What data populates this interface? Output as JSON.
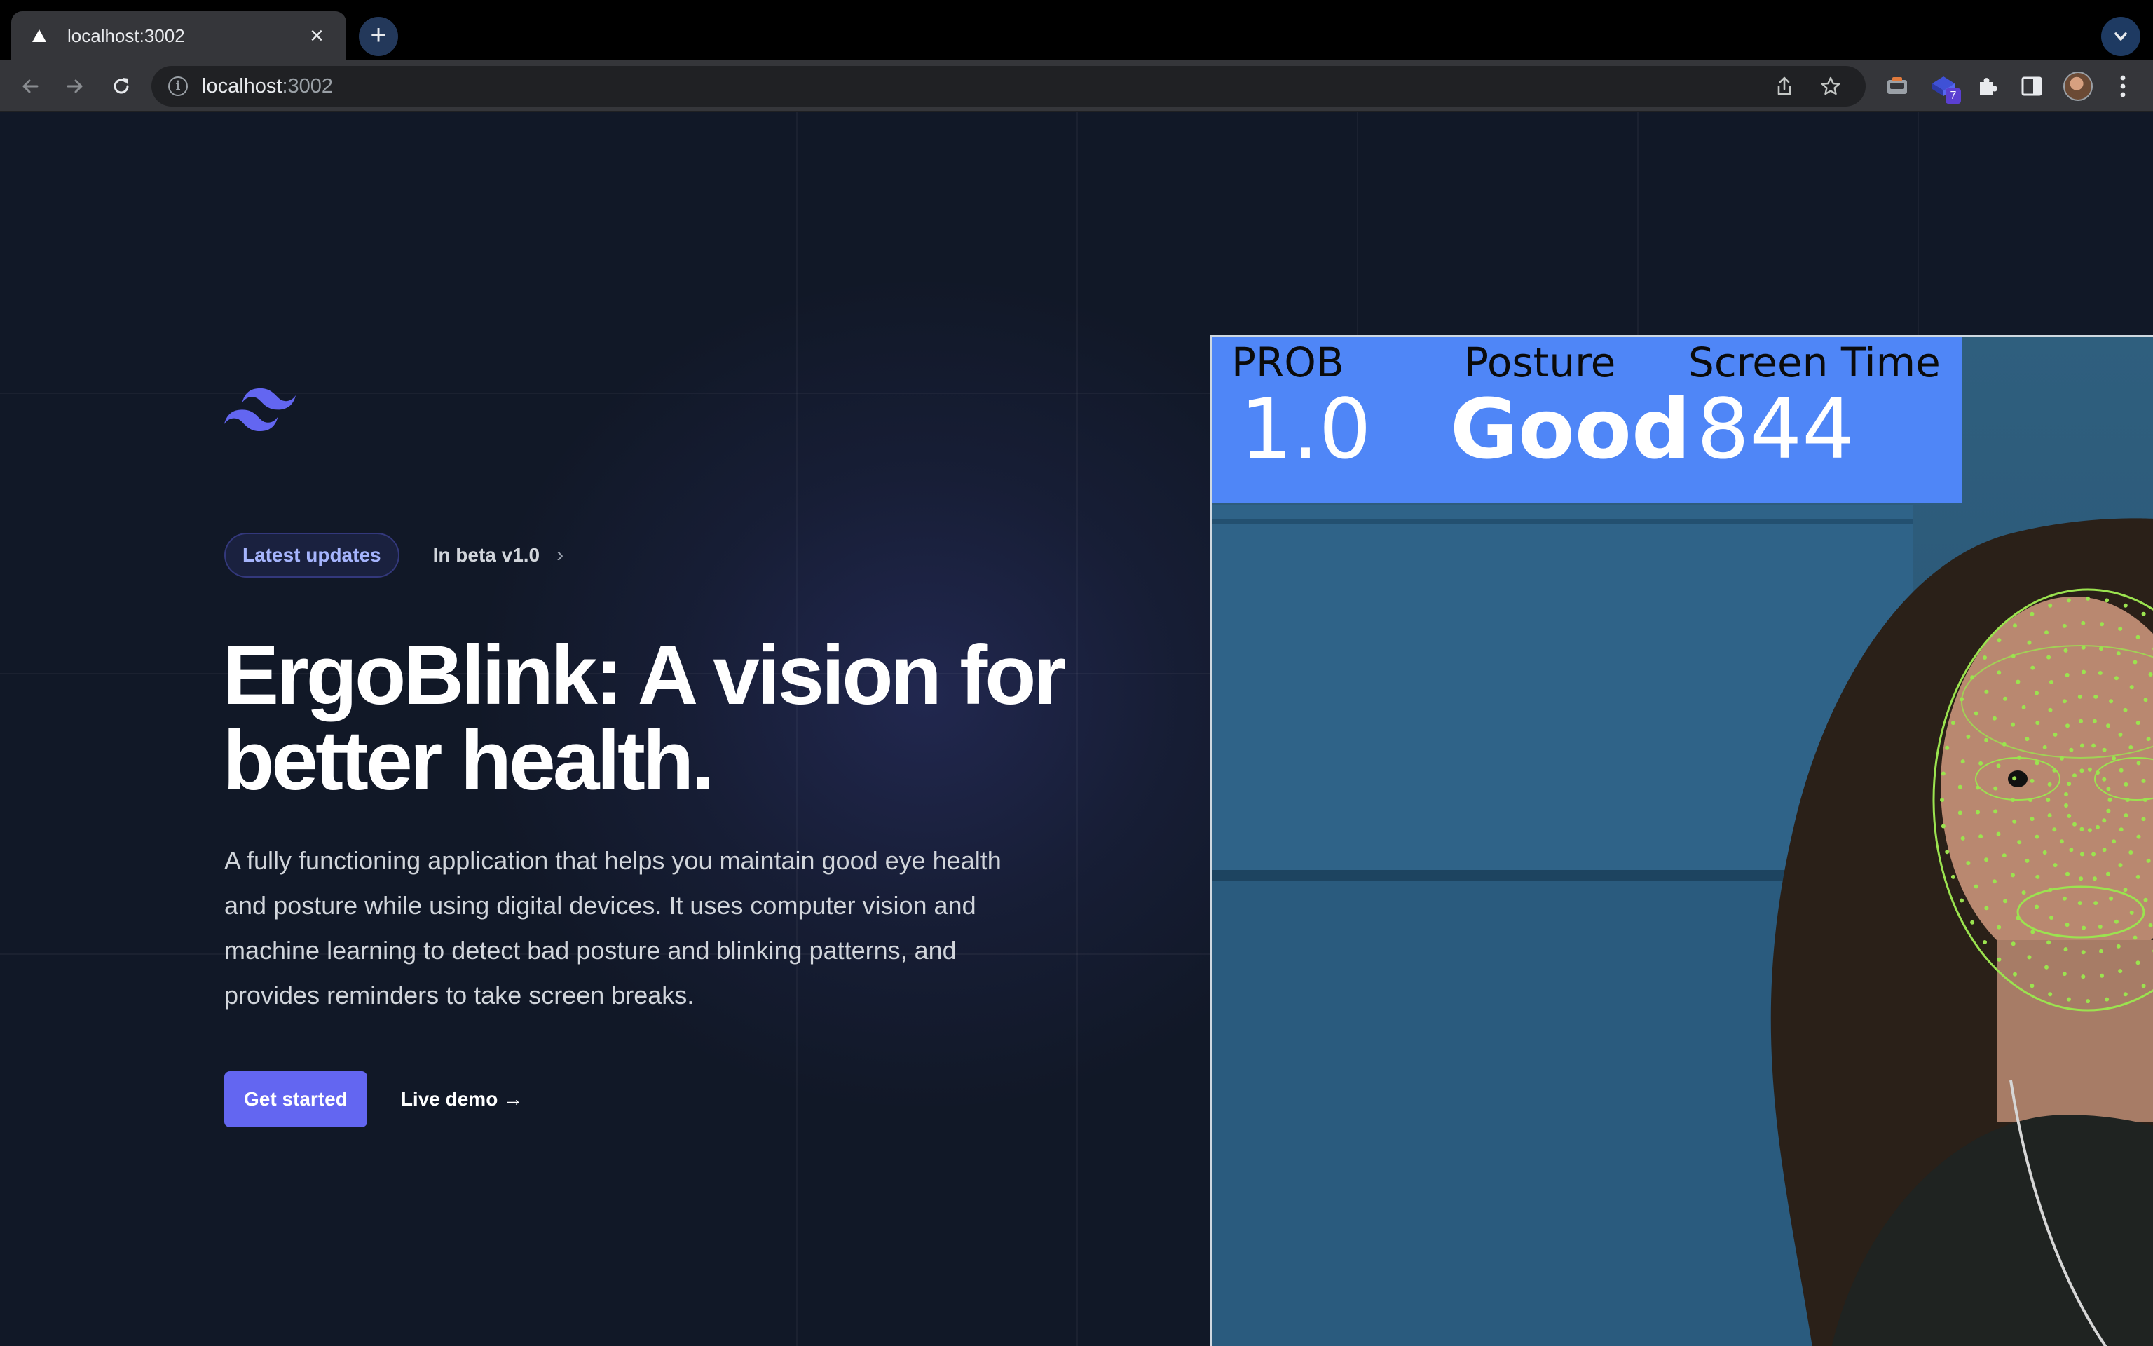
{
  "browser": {
    "tab_title": "localhost:3002",
    "close_glyph": "×",
    "new_tab_glyph": "+",
    "url_host": "localhost",
    "url_port": ":3002",
    "extension_badge": "7",
    "icons": [
      "vercel-favicon-icon",
      "close-icon",
      "plus-icon",
      "chevron-down-icon",
      "back-arrow-icon",
      "forward-arrow-icon",
      "reload-icon",
      "info-icon",
      "share-icon",
      "star-icon",
      "extension-icon",
      "puzzle-icon",
      "side-panel-icon",
      "profile-avatar",
      "kebab-menu-icon"
    ]
  },
  "hero": {
    "badge_label": "Latest updates",
    "beta_label": "In beta v1.0",
    "beta_chevron": "›",
    "headline": "ErgoBlink: A vision for better health.",
    "description": "A fully functioning application that helps you maintain good eye health and posture while using digital devices. It uses computer vision and machine learning to detect bad posture and blinking patterns, and provides reminders to take screen breaks.",
    "primary_cta": "Get started",
    "secondary_cta": "Live demo →"
  },
  "feed": {
    "prob_label": "PROB",
    "prob_value": "1.0",
    "posture_label": "Posture",
    "posture_value": "Good",
    "screen_time_label": "Screen Time",
    "screen_time_value": "844"
  },
  "colors": {
    "accent": "#6366f1",
    "accent_light": "#a5b4fc",
    "background": "#111827",
    "hud_blue": "#4f86f7",
    "mesh_green": "#9be34f"
  }
}
